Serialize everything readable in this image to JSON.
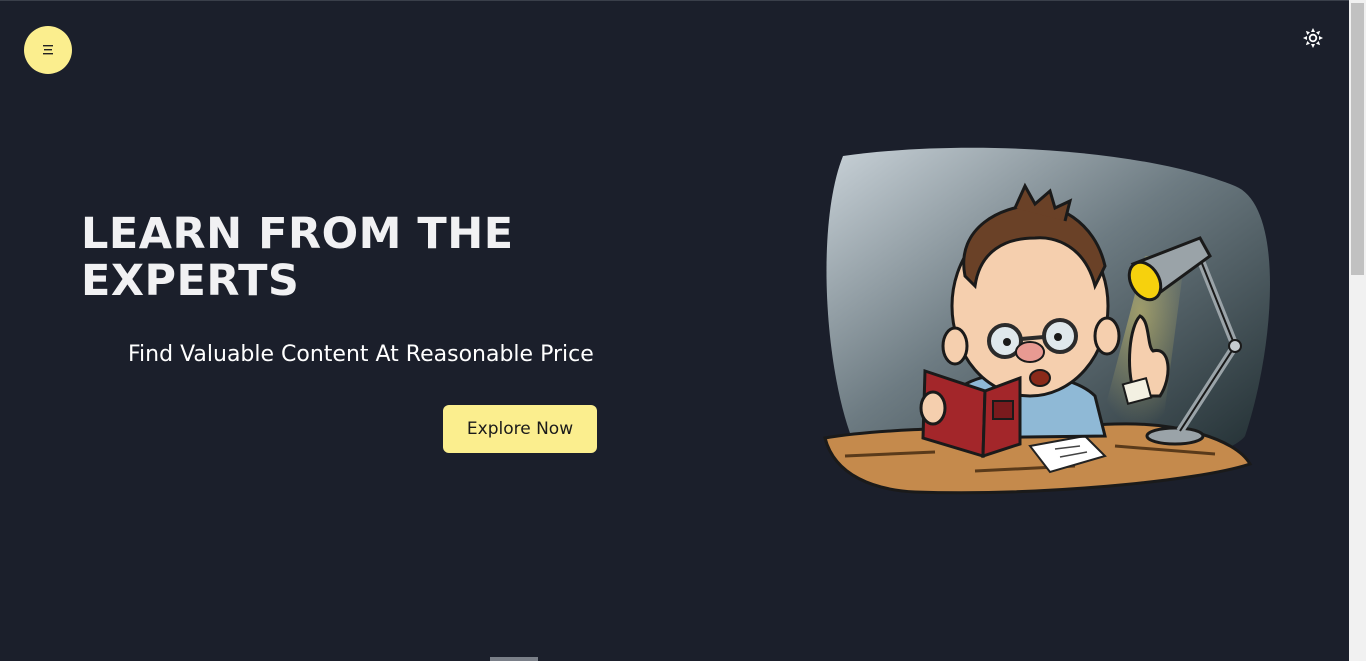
{
  "header": {
    "menu_icon": "hamburger-menu-icon",
    "theme_icon": "sun-icon"
  },
  "hero": {
    "title_line1": "LEARN FROM THE",
    "title_line2": "EXPERTS",
    "subtitle": "Find Valuable Content At Reasonable Price",
    "cta_label": "Explore Now"
  },
  "illustration": {
    "subject": "cartoon-professor-reading-book-illustration"
  },
  "colors": {
    "background": "#1b1f2b",
    "accent": "#fbee8e",
    "text": "#f1f1f3"
  }
}
